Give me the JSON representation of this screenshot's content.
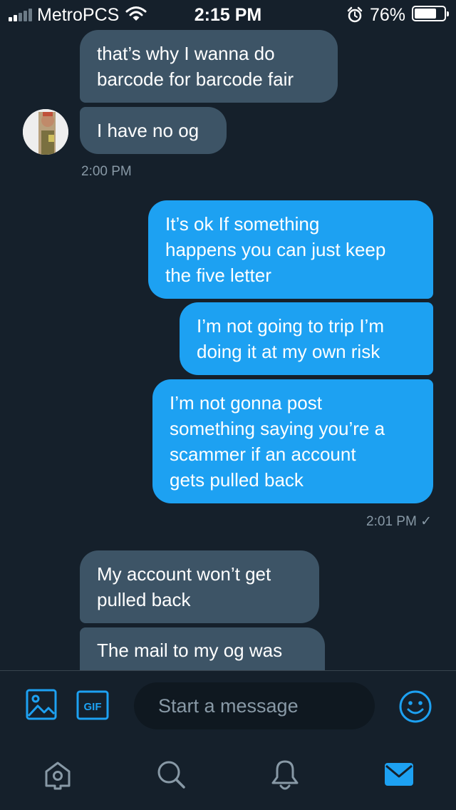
{
  "status_bar": {
    "carrier": "MetroPCS",
    "time": "2:15 PM",
    "battery_percent": "76%",
    "battery_level": 0.76,
    "signal_bars_filled": 2,
    "signal_bars_total": 5
  },
  "conversation": {
    "messages": [
      {
        "direction": "incoming",
        "text": "that’s why I wanna do\nbarcode for barcode fair"
      },
      {
        "direction": "incoming",
        "text": "I have no og"
      },
      {
        "direction": "outgoing",
        "text": "It’s ok If something\nhappens you can just keep\nthe five letter"
      },
      {
        "direction": "outgoing",
        "text": "I’m not going to trip I’m\ndoing it at my own risk"
      },
      {
        "direction": "outgoing",
        "text": "I’m not gonna post\nsomething saying you’re a\nscammer if an account\ngets pulled back"
      },
      {
        "direction": "incoming",
        "text": "My account won’t get\npulled back"
      },
      {
        "direction": "incoming",
        "text": "The mail to my og was"
      }
    ],
    "timestamps": {
      "first_group": "2:00 PM",
      "second_group": "2:01 PM"
    },
    "read_receipt": "✓"
  },
  "compose": {
    "placeholder": "Start a message",
    "gif_label": "GIF"
  },
  "colors": {
    "background": "#15202b",
    "incoming_bubble": "#3d5466",
    "outgoing_bubble": "#1da1f2",
    "accent": "#1da1f2",
    "muted_text": "#8899a6"
  },
  "icons": {
    "status": [
      "signal-icon",
      "wifi-icon",
      "alarm-icon",
      "battery-icon"
    ],
    "compose": [
      "image-icon",
      "gif-icon",
      "emoji-icon"
    ],
    "tabs": [
      "home-icon",
      "search-icon",
      "notifications-icon",
      "messages-icon"
    ]
  },
  "tabs": {
    "active": "messages"
  }
}
